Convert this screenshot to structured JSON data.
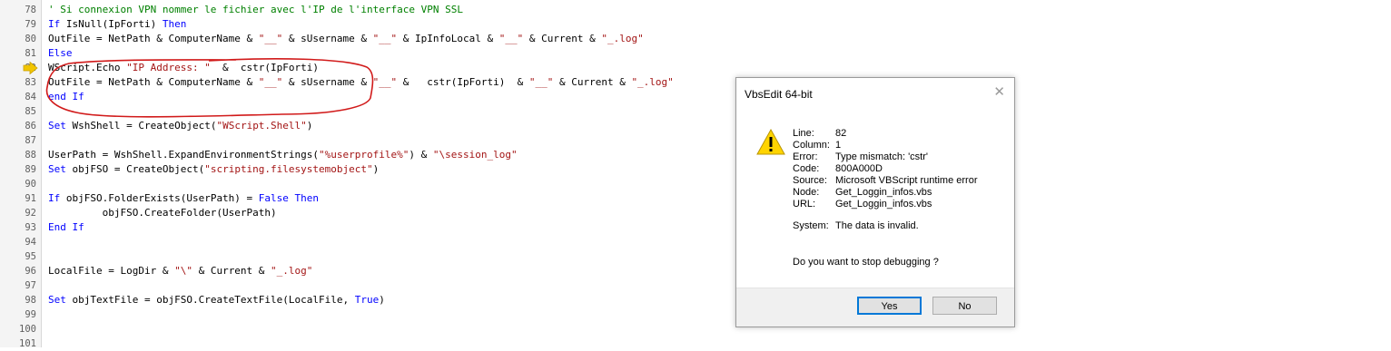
{
  "editor": {
    "lines": [
      {
        "num": "78",
        "segs": [
          {
            "t": "' Si connexion VPN nommer le fichier avec l'IP de l'interface VPN SSL",
            "c": "cm"
          }
        ]
      },
      {
        "num": "79",
        "segs": [
          {
            "t": "If ",
            "c": "kw"
          },
          {
            "t": "IsNull(IpForti) "
          },
          {
            "t": "Then",
            "c": "kw"
          }
        ]
      },
      {
        "num": "80",
        "segs": [
          {
            "t": "OutFile = NetPath & ComputerName & "
          },
          {
            "t": "\"__\"",
            "c": "str"
          },
          {
            "t": " & sUsername & "
          },
          {
            "t": "\"__\"",
            "c": "str"
          },
          {
            "t": " & IpInfoLocal & "
          },
          {
            "t": "\"__\"",
            "c": "str"
          },
          {
            "t": " & Current & "
          },
          {
            "t": "\"_.log\"",
            "c": "str"
          }
        ]
      },
      {
        "num": "81",
        "segs": [
          {
            "t": "Else",
            "c": "kw"
          }
        ]
      },
      {
        "num": "82",
        "segs": [
          {
            "t": "WScript.Echo "
          },
          {
            "t": "\"IP Address: \"",
            "c": "str"
          },
          {
            "t": "  &  cstr(IpForti)"
          }
        ]
      },
      {
        "num": "83",
        "segs": [
          {
            "t": "OutFile = NetPath & ComputerName & "
          },
          {
            "t": "\"__\"",
            "c": "str"
          },
          {
            "t": " & sUsername & "
          },
          {
            "t": "\"__\"",
            "c": "str"
          },
          {
            "t": " &   cstr(IpForti)  & "
          },
          {
            "t": "\"__\"",
            "c": "str"
          },
          {
            "t": " & Current & "
          },
          {
            "t": "\"_.log\"",
            "c": "str"
          }
        ]
      },
      {
        "num": "84",
        "segs": [
          {
            "t": "end If",
            "c": "kw"
          }
        ]
      },
      {
        "num": "85",
        "segs": []
      },
      {
        "num": "86",
        "segs": [
          {
            "t": "Set ",
            "c": "kw"
          },
          {
            "t": "WshShell = CreateObject("
          },
          {
            "t": "\"WScript.Shell\"",
            "c": "str"
          },
          {
            "t": ")"
          }
        ]
      },
      {
        "num": "87",
        "segs": []
      },
      {
        "num": "88",
        "segs": [
          {
            "t": "UserPath = WshShell.ExpandEnvironmentStrings("
          },
          {
            "t": "\"%userprofile%\"",
            "c": "str"
          },
          {
            "t": ") & "
          },
          {
            "t": "\"\\session_log\"",
            "c": "str"
          }
        ]
      },
      {
        "num": "89",
        "segs": [
          {
            "t": "Set ",
            "c": "kw"
          },
          {
            "t": "objFSO = CreateObject("
          },
          {
            "t": "\"scripting.filesystemobject\"",
            "c": "str"
          },
          {
            "t": ")"
          }
        ]
      },
      {
        "num": "90",
        "segs": []
      },
      {
        "num": "91",
        "segs": [
          {
            "t": "If ",
            "c": "kw"
          },
          {
            "t": "objFSO.FolderExists(UserPath) = "
          },
          {
            "t": "False Then",
            "c": "kw"
          }
        ]
      },
      {
        "num": "92",
        "segs": [
          {
            "t": "         objFSO.CreateFolder(UserPath)"
          }
        ]
      },
      {
        "num": "93",
        "segs": [
          {
            "t": "End If",
            "c": "kw"
          }
        ]
      },
      {
        "num": "94",
        "segs": []
      },
      {
        "num": "95",
        "segs": []
      },
      {
        "num": "96",
        "segs": [
          {
            "t": "LocalFile = LogDir & "
          },
          {
            "t": "\"\\\"",
            "c": "str"
          },
          {
            "t": " & Current & "
          },
          {
            "t": "\"_.log\"",
            "c": "str"
          }
        ]
      },
      {
        "num": "97",
        "segs": []
      },
      {
        "num": "98",
        "segs": [
          {
            "t": "Set ",
            "c": "kw"
          },
          {
            "t": "objTextFile = objFSO.CreateTextFile(LocalFile, "
          },
          {
            "t": "True",
            "c": "kw"
          },
          {
            "t": ")"
          }
        ]
      },
      {
        "num": "99",
        "segs": []
      },
      {
        "num": "100",
        "segs": []
      },
      {
        "num": "101",
        "segs": []
      }
    ],
    "colors": {
      "keyword": "#0000ff",
      "comment": "#008000",
      "string": "#a31515",
      "annotation": "#d11a1a",
      "arrow": "#f2c500"
    }
  },
  "dialog": {
    "title": "VbsEdit 64-bit",
    "close_icon": "close-icon",
    "icon": "warning-icon",
    "info": {
      "line_label": "Line:",
      "line_value": "82",
      "column_label": "Column:",
      "column_value": "1",
      "error_label": "Error:",
      "error_value": "Type mismatch: 'cstr'",
      "code_label": "Code:",
      "code_value": "800A000D",
      "source_label": "Source:",
      "source_value": "Microsoft VBScript runtime error",
      "node_label": "Node:",
      "node_value": "Get_Loggin_infos.vbs",
      "url_label": "URL:",
      "url_value": "Get_Loggin_infos.vbs",
      "system_label": "System:",
      "system_value": "The data is invalid."
    },
    "question": "Do you want to stop debugging ?",
    "yes_label": "Yes",
    "no_label": "No"
  }
}
